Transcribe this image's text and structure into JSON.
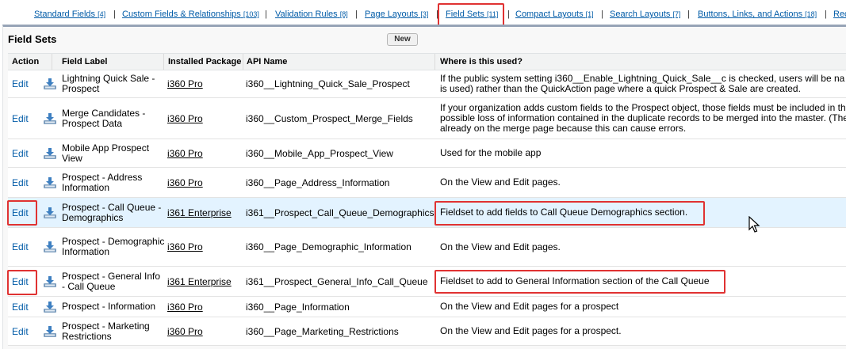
{
  "nav": {
    "tabs": [
      {
        "label": "Standard Fields",
        "count": "[4]"
      },
      {
        "label": "Custom Fields & Relationships",
        "count": "[103]"
      },
      {
        "label": "Validation Rules",
        "count": "[8]"
      },
      {
        "label": "Page Layouts",
        "count": "[3]"
      },
      {
        "label": "Field Sets",
        "count": "[11]"
      },
      {
        "label": "Compact Layouts",
        "count": "[1]"
      },
      {
        "label": "Search Layouts",
        "count": "[7]"
      },
      {
        "label": "Buttons, Links, and Actions",
        "count": "[18]"
      },
      {
        "label": "Rec",
        "count": ""
      }
    ]
  },
  "panel": {
    "title": "Field Sets",
    "new_button": "New"
  },
  "table": {
    "headers": [
      "Action",
      "Field Label",
      "Installed Package",
      "API Name",
      "Where is this used?"
    ],
    "rows": [
      {
        "action": "Edit",
        "label": "Lightning Quick Sale - Prospect",
        "package": "i360 Pro",
        "api": "i360__Lightning_Quick_Sale_Prospect",
        "where": [
          "If the public system setting i360__Enable_Lightning_Quick_Sale__c is checked, users will be na",
          "is used) rather than the QuickAction page where a quick Prospect & Sale are created."
        ]
      },
      {
        "action": "Edit",
        "label": "Merge Candidates - Prospect Data",
        "package": "i360 Pro",
        "api": "i360__Custom_Prospect_Merge_Fields",
        "where": [
          "If your organization adds custom fields to the Prospect object, those fields must be included in th",
          "possible loss of information contained in the duplicate records to be merged into the master. (The",
          "already on the merge page because this can cause errors."
        ]
      },
      {
        "action": "Edit",
        "label": "Mobile App Prospect View",
        "package": "i360 Pro",
        "api": "i360__Mobile_App_Prospect_View",
        "where": [
          "Used for the mobile app"
        ]
      },
      {
        "action": "Edit",
        "label": "Prospect - Address Information",
        "package": "i360 Pro",
        "api": "i360__Page_Address_Information",
        "where": [
          "On the View and Edit pages."
        ]
      },
      {
        "action": "Edit",
        "label": "Prospect - Call Queue - Demographics",
        "package": "i361 Enterprise",
        "api": "i361__Prospect_Call_Queue_Demographics",
        "where": [
          "Fieldset to add fields to Call Queue Demographics section."
        ]
      },
      {
        "action": "Edit",
        "label": "Prospect - Demographic Information",
        "package": "i360 Pro",
        "api": "i360__Page_Demographic_Information",
        "where": [
          "On the View and Edit pages."
        ]
      },
      {
        "action": "Edit",
        "label": "Prospect - General Info - Call Queue",
        "package": "i361 Enterprise",
        "api": "i361__Prospect_General_Info_Call_Queue",
        "where": [
          "Fieldset to add to General Information section of the Call Queue"
        ]
      },
      {
        "action": "Edit",
        "label": "Prospect - Information",
        "package": "i360 Pro",
        "api": "i360__Page_Information",
        "where": [
          "On the View and Edit pages for a prospect"
        ]
      },
      {
        "action": "Edit",
        "label": "Prospect - Marketing Restrictions",
        "package": "i360 Pro",
        "api": "i360__Page_Marketing_Restrictions",
        "where": [
          "On the View and Edit pages for a prospect."
        ]
      }
    ]
  },
  "colors": {
    "link": "#015ba7",
    "highlight": "#e03232",
    "selected_row": "#e3f3ff",
    "panel_border": "#97a4b6"
  },
  "icons": {
    "row_icon": "download-icon",
    "cursor": "mouse-cursor-icon"
  }
}
